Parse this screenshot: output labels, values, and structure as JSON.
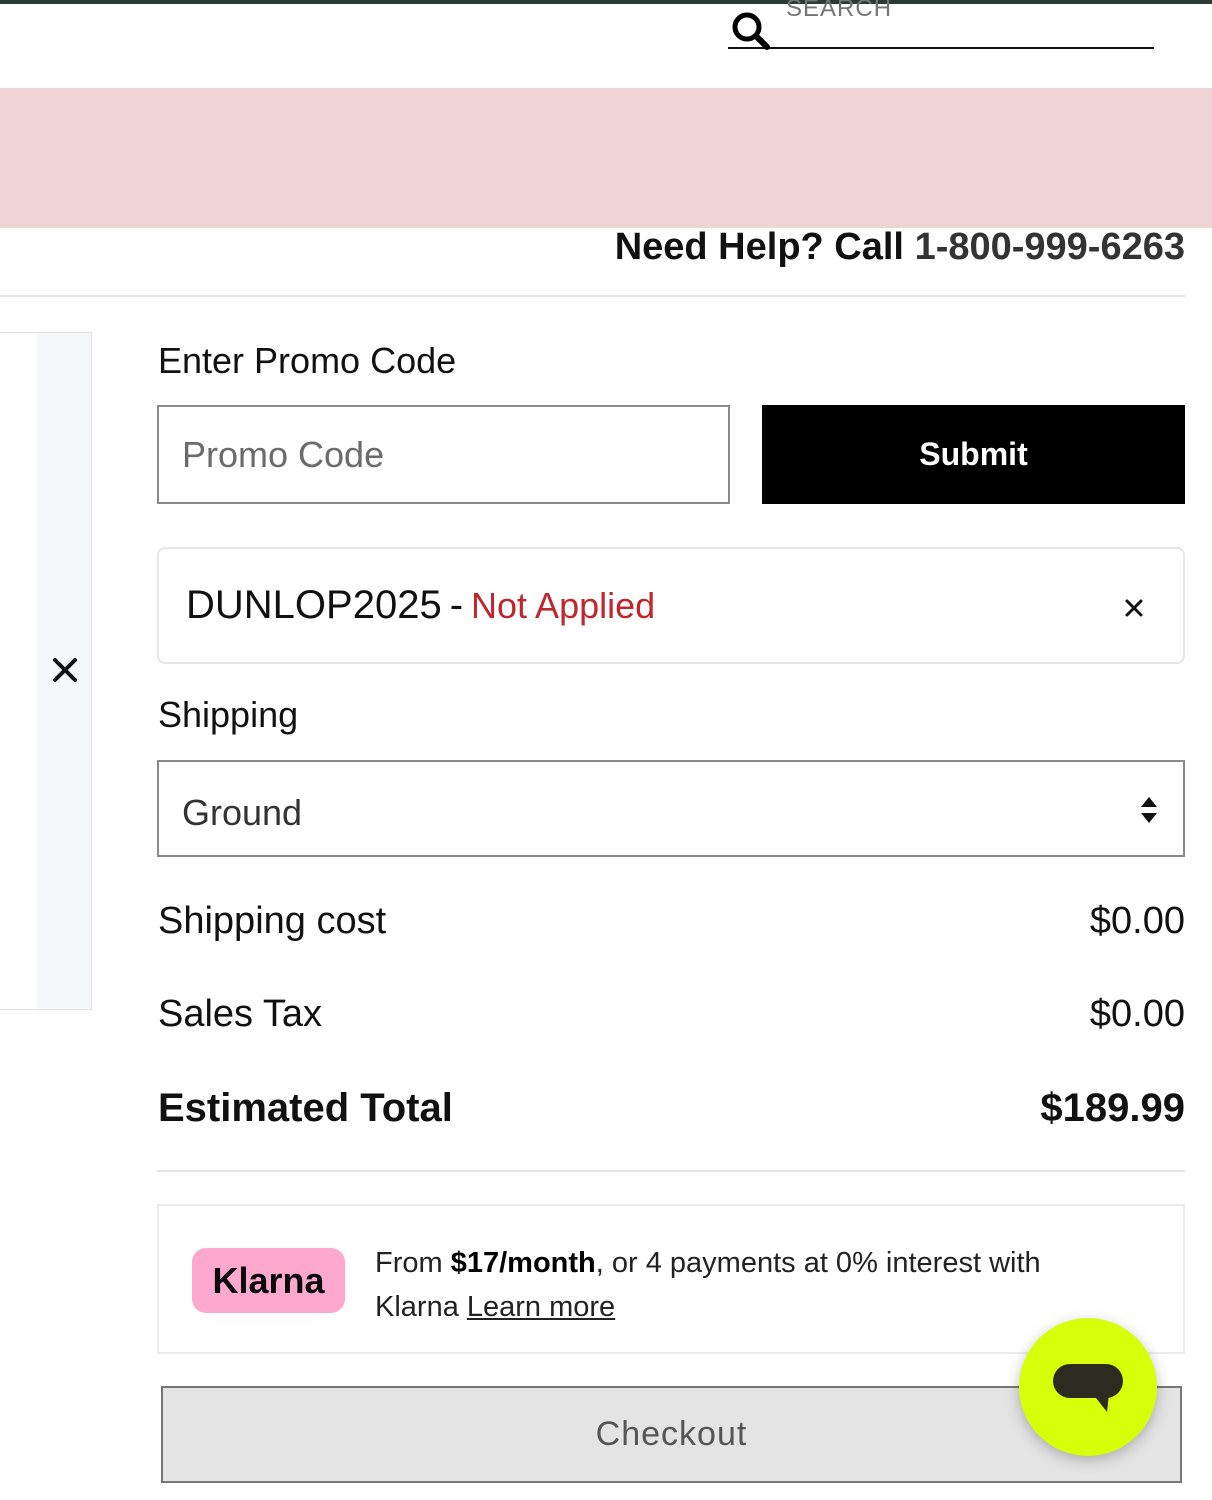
{
  "header": {
    "search_placeholder": "SEARCH",
    "help_prefix": "Need Help? Call",
    "help_phone": "1-800-999-6263"
  },
  "promo": {
    "label": "Enter Promo Code",
    "input_placeholder": "Promo Code",
    "submit_label": "Submit",
    "applied_code": "DUNLOP2025",
    "separator": "-",
    "applied_status": "Not Applied",
    "status_color": "#c0262d"
  },
  "shipping": {
    "label": "Shipping",
    "selected_option": "Ground"
  },
  "summary": {
    "rows": [
      {
        "label": "Shipping cost",
        "value": "$0.00"
      },
      {
        "label": "Sales Tax",
        "value": "$0.00"
      }
    ],
    "total_label": "Estimated Total",
    "total_value": "$189.99"
  },
  "klarna": {
    "logo_text": "Klarna",
    "text_from": "From",
    "monthly_amount": "$17/month",
    "text_rest": ", or 4 payments at 0% interest with Klarna",
    "learn_more": "Learn more",
    "brand_color": "#ffa8cd"
  },
  "checkout": {
    "label": "Checkout"
  },
  "chat": {
    "icon": "chat-bubble-icon",
    "color": "#d7ff0a"
  },
  "banner": {
    "color": "#f0d3d4"
  }
}
